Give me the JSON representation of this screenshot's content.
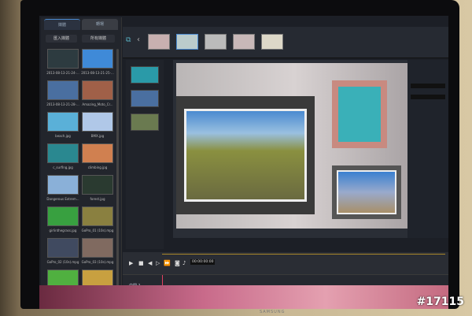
{
  "media_panel": {
    "tabs": [
      "媒體",
      "轉場"
    ],
    "import_label": "匯入媒體",
    "filter_label": "所有媒體",
    "items": [
      {
        "name": "2013-08-13-21-24-...",
        "color": "#2d3b40"
      },
      {
        "name": "2013-08-13-21-25-...",
        "color": "#3f8ad8"
      },
      {
        "name": "2013-08-13-21-28-...",
        "color": "#4a6fa0"
      },
      {
        "name": "Amazing_Moto_Cr...",
        "color": "#a06048"
      },
      {
        "name": "beach.jpg",
        "color": "#5ab0d8"
      },
      {
        "name": "BMX.jpg",
        "color": "#b0c8e8"
      },
      {
        "name": "c_surfing.jpg",
        "color": "#2a8890"
      },
      {
        "name": "climbing.jpg",
        "color": "#d08050"
      },
      {
        "name": "Dangerous Extrem...",
        "color": "#8ab0d8"
      },
      {
        "name": "forest.jpg",
        "color": "#2a3a30"
      },
      {
        "name": "girlinthegrass.jpg",
        "color": "#38a040"
      },
      {
        "name": "GoPro_01 (10s).mpg",
        "color": "#8a8040"
      },
      {
        "name": "GoPro_02 (10s).mpg",
        "color": "#404a60"
      },
      {
        "name": "GoPro_03 (10s).mpg",
        "color": "#806a60"
      },
      {
        "name": "",
        "color": "#50b040"
      },
      {
        "name": "",
        "color": "#c8a040"
      }
    ]
  },
  "transport": {
    "timecode": "00:00:00:00"
  },
  "timeline": {
    "track_label": "中間 1"
  },
  "watermark": "#17115",
  "monitor_brand": "SAMSUNG"
}
